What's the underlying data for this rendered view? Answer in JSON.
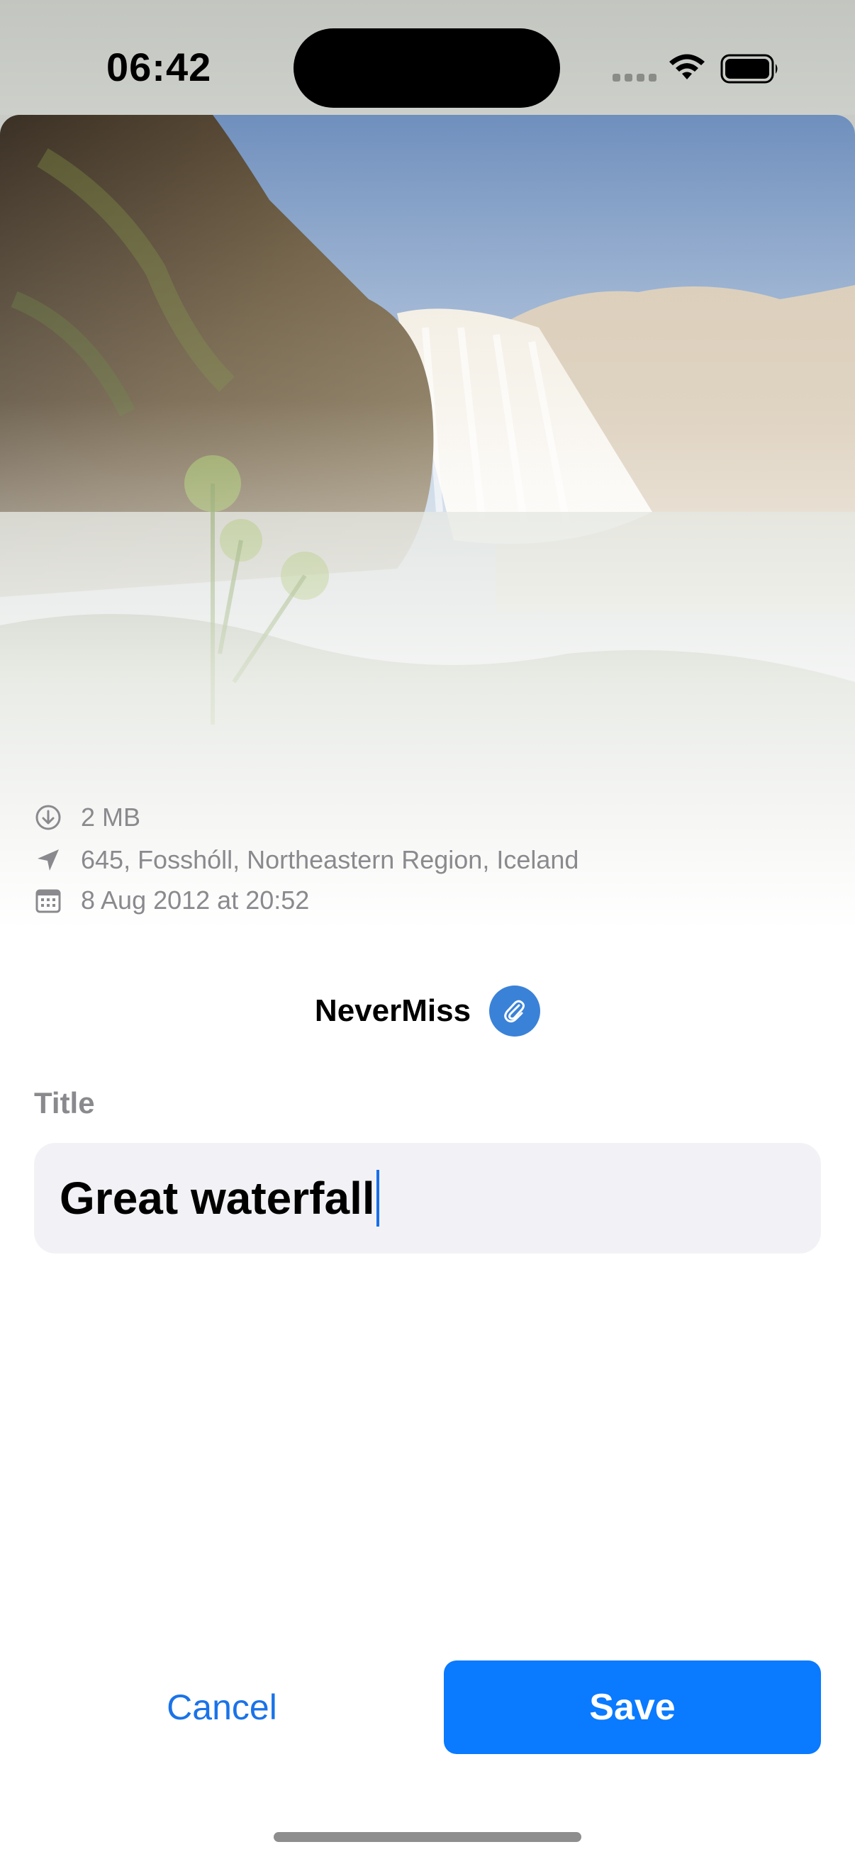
{
  "status_bar": {
    "time": "06:42"
  },
  "photo": {
    "subject": "waterfall landscape"
  },
  "metadata": {
    "size": "2 MB",
    "location": "645, Fosshóll, Northeastern Region, Iceland",
    "date": "8 Aug 2012 at 20:52"
  },
  "app": {
    "name": "NeverMiss",
    "badge_icon": "paperclip-icon"
  },
  "form": {
    "title_label": "Title",
    "title_value": "Great waterfall"
  },
  "actions": {
    "cancel_label": "Cancel",
    "save_label": "Save"
  },
  "colors": {
    "accent": "#0a7aff",
    "badge": "#3a82d8",
    "secondary_text": "#8a8a8e"
  }
}
